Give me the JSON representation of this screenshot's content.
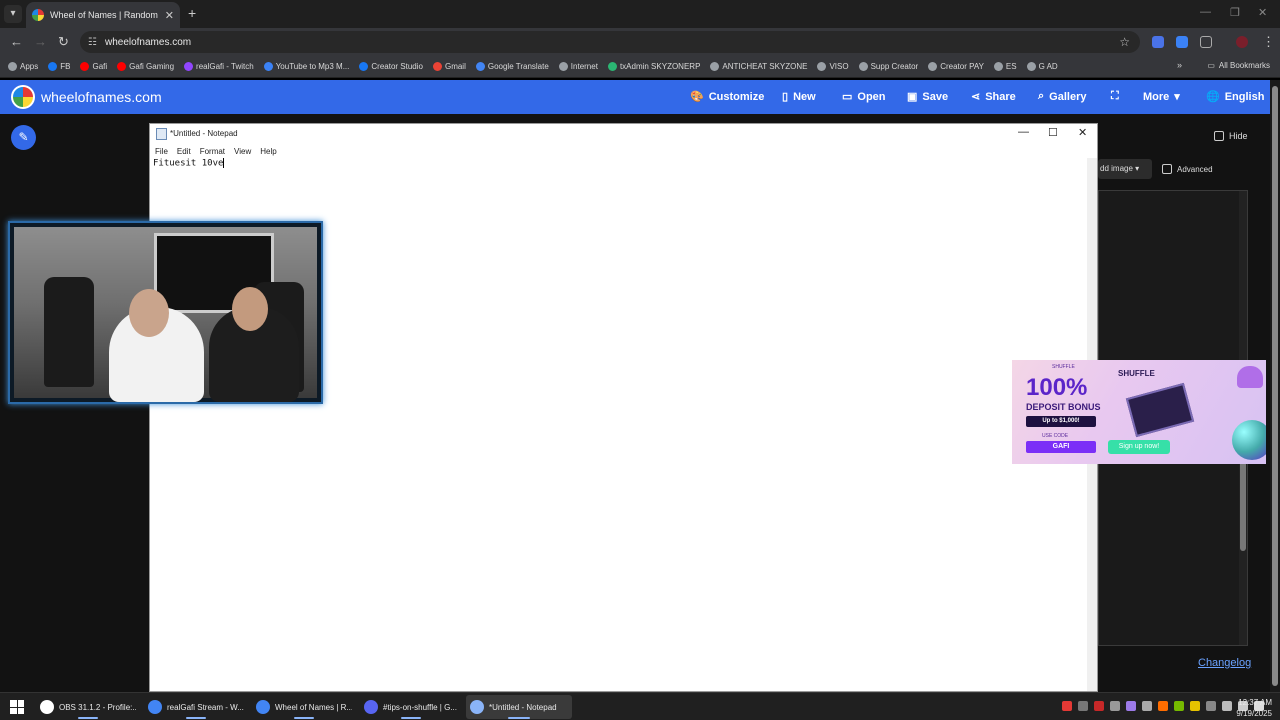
{
  "browser": {
    "tab_title": "Wheel of Names | Random nam",
    "url": "wheelofnames.com",
    "bookmarks": [
      {
        "label": "Apps",
        "color": "#9aa0a6"
      },
      {
        "label": "FB",
        "color": "#1877f2"
      },
      {
        "label": "Gafi",
        "color": "#ff0000"
      },
      {
        "label": "Gafi Gaming",
        "color": "#ff0000"
      },
      {
        "label": "realGafi - Twitch",
        "color": "#9146ff"
      },
      {
        "label": "YouTube to Mp3 M...",
        "color": "#3b82f6"
      },
      {
        "label": "Creator Studio",
        "color": "#1877f2"
      },
      {
        "label": "Gmail",
        "color": "#ea4335"
      },
      {
        "label": "Google Translate",
        "color": "#4285f4"
      },
      {
        "label": "Internet",
        "color": "#9aa0a6"
      },
      {
        "label": "txAdmin SKYZONERP",
        "color": "#2bb673"
      },
      {
        "label": "ANTICHEAT SKYZONE",
        "color": "#9aa0a6"
      },
      {
        "label": "VISO",
        "color": "#9aa0a6"
      },
      {
        "label": "Supp Creator",
        "color": "#9aa0a6"
      },
      {
        "label": "Creator PAY",
        "color": "#9aa0a6"
      },
      {
        "label": "ES",
        "color": "#9aa0a6"
      },
      {
        "label": "G AD",
        "color": "#9aa0a6"
      }
    ],
    "all_bookmarks": "All Bookmarks"
  },
  "site": {
    "title": "wheelofnames.com",
    "nav": {
      "customize": "Customize",
      "new": "New",
      "open": "Open",
      "save": "Save",
      "share": "Share",
      "gallery": "Gallery",
      "more": "More",
      "language": "English"
    },
    "hide_label": "Hide",
    "add_image_label": "dd image",
    "advanced_label": "Advanced",
    "changelog": "Changelog"
  },
  "notepad": {
    "title": "*Untitled - Notepad",
    "menu": [
      "File",
      "Edit",
      "Format",
      "View",
      "Help"
    ],
    "content": "Fituesit 10ve"
  },
  "ad": {
    "small_text": "SHUFFLE",
    "percent": "100%",
    "headline": "DEPOSIT BONUS",
    "upto": "Up to $1,000!",
    "use_code": "USE CODE",
    "code": "GAFI",
    "brand": "SHUFFLE",
    "cta": "Sign up now!"
  },
  "taskbar": {
    "items": [
      {
        "label": "OBS 31.1.2 - Profile:...",
        "color": "#ffffff"
      },
      {
        "label": "realGafi Stream - W...",
        "color": "#4285f4"
      },
      {
        "label": "Wheel of Names | R...",
        "color": "#4285f4"
      },
      {
        "label": "#tips-on-shuffle | G...",
        "color": "#5865f2"
      },
      {
        "label": "*Untitled - Notepad",
        "color": "#8ab4f8"
      }
    ],
    "time": "12:37 AM",
    "date": "9/19/2025"
  }
}
